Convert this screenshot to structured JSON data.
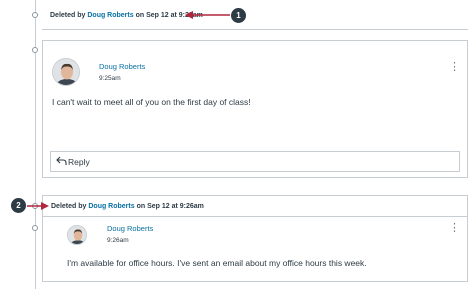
{
  "entries": {
    "deleted1": {
      "prefix": "Deleted by",
      "name": "Doug Roberts",
      "suffix": "on Sep 12 at 9:22am"
    },
    "post1": {
      "author": "Doug Roberts",
      "time": "9:25am",
      "message": "I can't wait to meet all of you on the first day of class!",
      "reply_label": "Reply",
      "menu_label": "⋮"
    },
    "deleted2": {
      "prefix": "Deleted by",
      "name": "Doug Roberts",
      "suffix": "on Sep 12 at 9:26am"
    },
    "post2": {
      "author": "Doug Roberts",
      "time": "9:26am",
      "message": "I'm available for office hours. I've sent an email about my office hours this week.",
      "menu_label": "⋮"
    }
  },
  "callouts": {
    "one": "1",
    "two": "2"
  },
  "colors": {
    "link": "#0770a3",
    "text": "#2d3b45",
    "border": "#c7cdd1",
    "callout": "#2d3b45",
    "arrow": "#b0263d"
  },
  "icons": {
    "reply": "reply-arrow-icon",
    "menu": "kebab-menu-icon",
    "avatar": "user-avatar-photo"
  }
}
